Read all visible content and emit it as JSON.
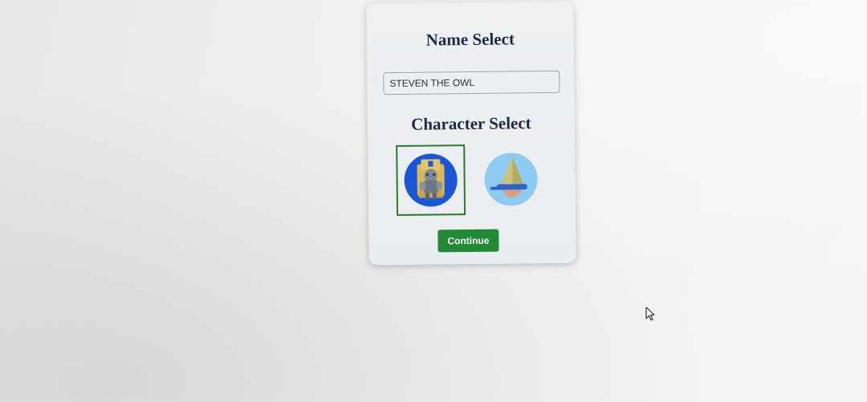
{
  "form": {
    "name_title": "Name Select",
    "name_value": "STEVEN THE OWL",
    "character_title": "Character Select",
    "characters": [
      {
        "icon": "knight-throne-avatar-icon",
        "selected": true
      },
      {
        "icon": "wizard-hat-avatar-icon",
        "selected": false
      }
    ],
    "continue_label": "Continue"
  },
  "colors": {
    "accent_green": "#228a35",
    "selection_border": "#2f7a2a",
    "avatar_blue": "#1a56d6",
    "avatar_sky": "#8fcaf0"
  }
}
